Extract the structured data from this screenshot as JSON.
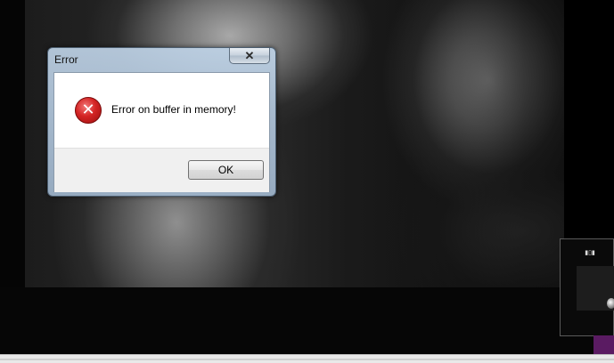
{
  "dialog": {
    "title": "Error",
    "close_symbol": "✕",
    "message": "Error on buffer in memory!",
    "ok_label": "OK",
    "icon": "error-icon"
  },
  "background": {
    "content": "black-and-white video frame"
  },
  "colors": {
    "error_red": "#d42424",
    "dialog_frame": "#aebccb",
    "accent_purple": "#5a1b62"
  }
}
